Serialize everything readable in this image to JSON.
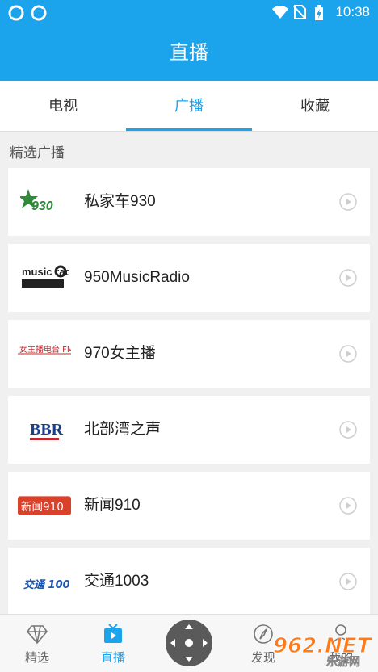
{
  "status_bar": {
    "time": "10:38",
    "icons": [
      "app-notification-icon",
      "app-notification-icon",
      "wifi-icon",
      "no-sim-icon",
      "battery-charging-icon"
    ]
  },
  "app_bar": {
    "title": "直播"
  },
  "tabs": [
    {
      "label": "电视",
      "active": false
    },
    {
      "label": "广播",
      "active": true
    },
    {
      "label": "收藏",
      "active": false
    }
  ],
  "section": {
    "title": "精选广播"
  },
  "stations": [
    {
      "name": "私家车930",
      "logo_text": "930",
      "logo_color": "#2f8a3a"
    },
    {
      "name": "950MusicRadio",
      "logo_text": "music radio",
      "logo_color": "#222222"
    },
    {
      "name": "970女主播",
      "logo_text": "女主播电台 FM 97.0",
      "logo_color": "#c0282d"
    },
    {
      "name": "北部湾之声",
      "logo_text": "BBR",
      "logo_color": "#1c3f8c"
    },
    {
      "name": "新闻910",
      "logo_text": "新闻910",
      "logo_color": "#d9412a"
    },
    {
      "name": "交通1003",
      "logo_text": "交通 1003",
      "logo_color": "#1b56b0"
    }
  ],
  "bottom_nav": [
    {
      "label": "精选",
      "icon": "diamond-icon",
      "active": false
    },
    {
      "label": "直播",
      "icon": "tv-icon",
      "active": true
    },
    {
      "label": "发现",
      "icon": "compass-icon",
      "active": false
    },
    {
      "label": "我的",
      "icon": "user-icon",
      "active": false
    }
  ],
  "watermark": {
    "text": "962.NET",
    "subtext": "乐游网"
  },
  "colors": {
    "accent": "#1ba3ec",
    "background": "#f0f0f0"
  }
}
